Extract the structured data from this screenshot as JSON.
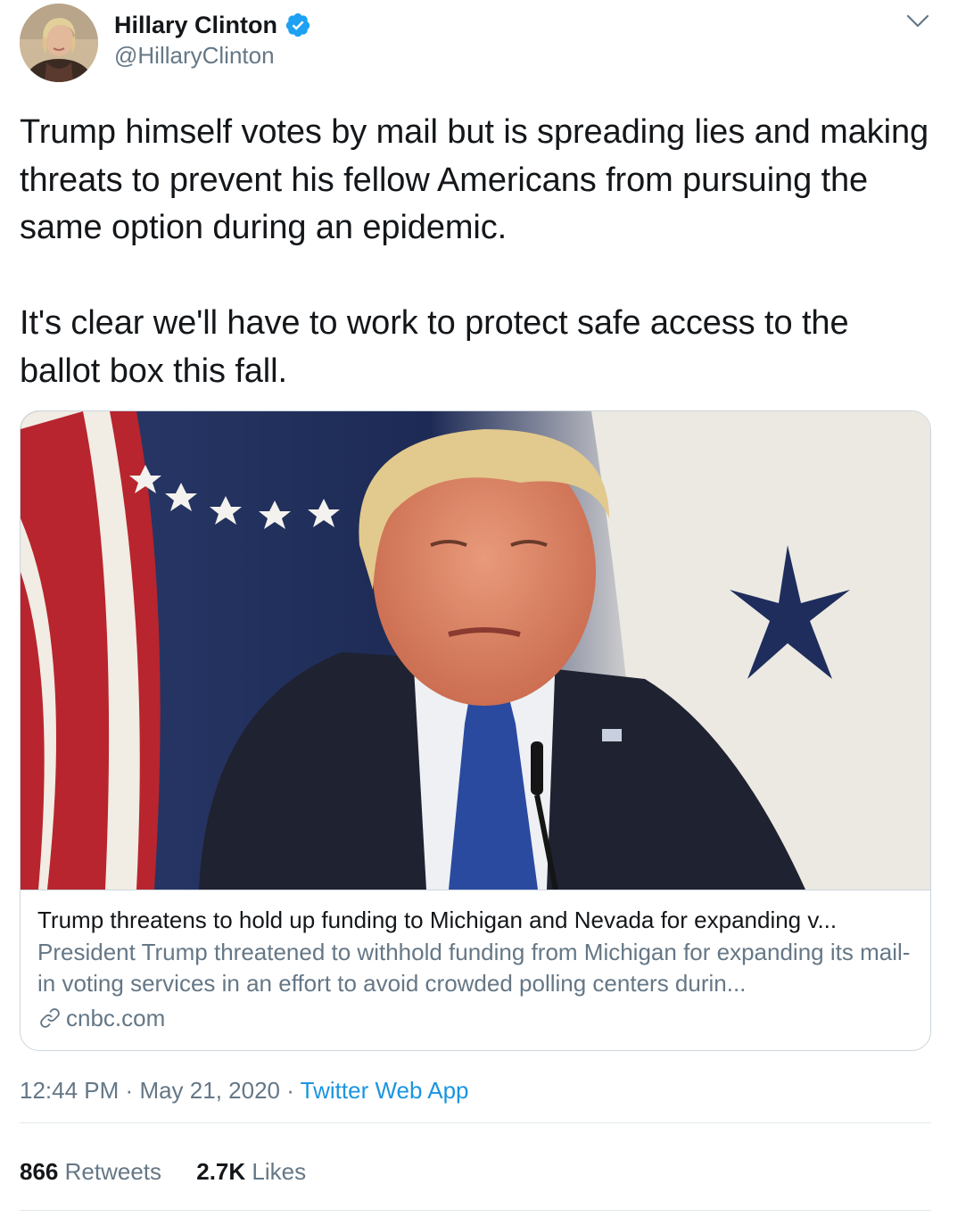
{
  "author": {
    "name": "Hillary Clinton",
    "handle": "@HillaryClinton",
    "verified": true
  },
  "tweet": {
    "paragraph1": "Trump himself votes by mail but is spreading lies and making threats to prevent his fellow Americans from pursuing the same option during an epidemic.",
    "paragraph2": "It's clear we'll have to work to protect safe access to the ballot box this fall."
  },
  "card": {
    "title": "Trump threatens to hold up funding to Michigan and Nevada for expanding v...",
    "description": "President Trump threatened to withhold funding from Michigan for expanding its mail-in voting services in an effort to avoid crowded polling centers durin...",
    "domain": "cnbc.com"
  },
  "meta": {
    "time": "12:44 PM",
    "separator": "·",
    "date": "May 21, 2020",
    "source": "Twitter Web App"
  },
  "stats": {
    "retweets_count": "866",
    "retweets_label": "Retweets",
    "likes_count": "2.7K",
    "likes_label": "Likes"
  },
  "colors": {
    "text": "#14171a",
    "secondary": "#657786",
    "accent": "#1b95e0",
    "border": "#ccd6dd"
  },
  "icons": [
    "verified-badge-icon",
    "chevron-down-icon",
    "link-icon"
  ]
}
